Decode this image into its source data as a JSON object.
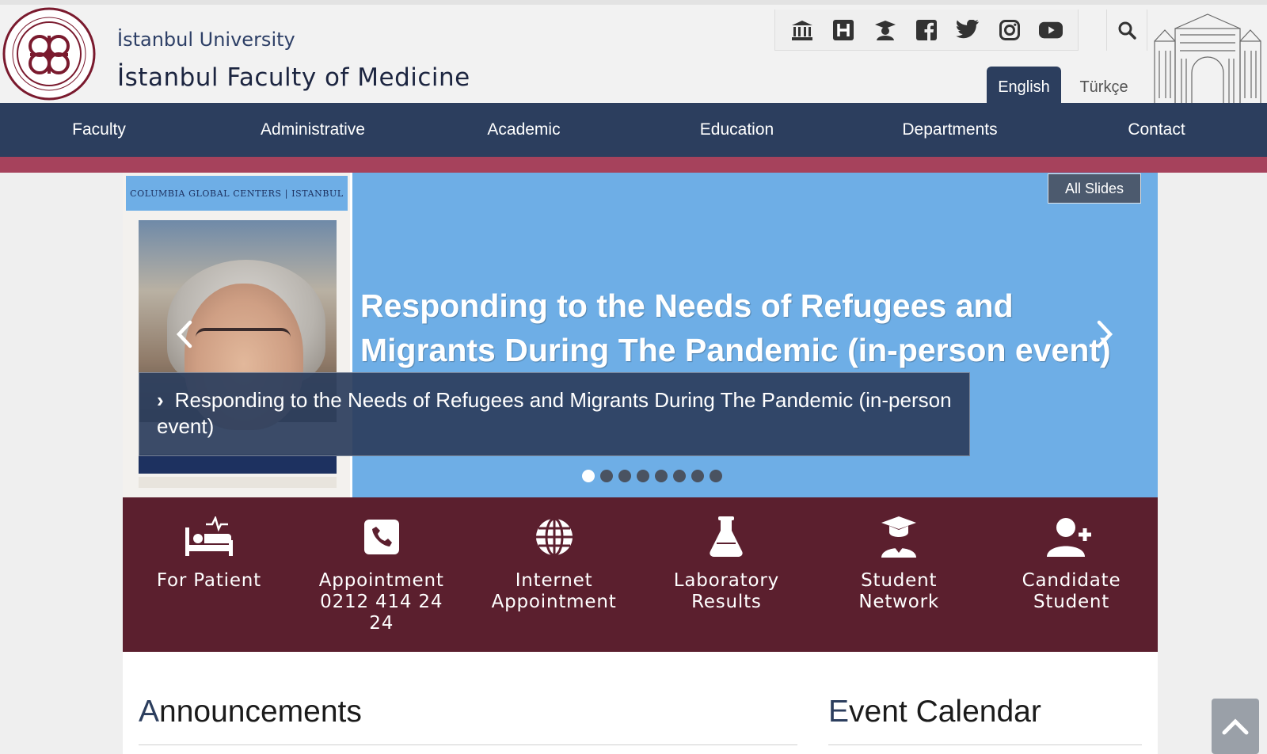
{
  "header": {
    "university": "İstanbul University",
    "faculty": "İstanbul Faculty of Medicine",
    "logo_text": "ISTANBUL UNIVERSITY · ISTANBUL FACULTY OF MEDICINE",
    "social_icons": [
      "university-icon",
      "hospital-icon",
      "graduate-icon",
      "facebook-icon",
      "twitter-icon",
      "instagram-icon",
      "youtube-icon"
    ],
    "search_icon": "search-icon",
    "languages": {
      "active": "English",
      "other": "Türkçe"
    }
  },
  "nav": {
    "items": [
      "Faculty",
      "Administrative",
      "Academic",
      "Education",
      "Departments",
      "Contact"
    ]
  },
  "slider": {
    "all_slides_label": "All Slides",
    "headline": "Responding to the Needs of Refugees and Migrants During  The Pandemic (in-person event)",
    "caption": "Responding to the Needs of Refugees and Migrants During The Pandemic (in-person event)",
    "poster_header": "COLUMBIA GLOBAL CENTERS | ISTANBUL",
    "dots_total": 8,
    "dots_active_index": 0
  },
  "quick_links": [
    {
      "icon": "patient-bed-icon",
      "label": "For Patient"
    },
    {
      "icon": "phone-icon",
      "label": "Appointment\n0212 414 24\n24"
    },
    {
      "icon": "globe-icon",
      "label": "Internet\nAppointment"
    },
    {
      "icon": "flask-icon",
      "label": "Laboratory\nResults"
    },
    {
      "icon": "graduate-icon",
      "label": "Student\nNetwork"
    },
    {
      "icon": "user-plus-icon",
      "label": "Candidate\nStudent"
    }
  ],
  "sections": {
    "announcements": {
      "first": "A",
      "rest": "nnouncements"
    },
    "events": {
      "first": "E",
      "rest": "vent Calendar"
    }
  },
  "colors": {
    "navy": "#2c3e5e",
    "accent_red": "#a6425c",
    "maroon": "#5b1f2e",
    "slide_blue": "#6eaee6"
  }
}
